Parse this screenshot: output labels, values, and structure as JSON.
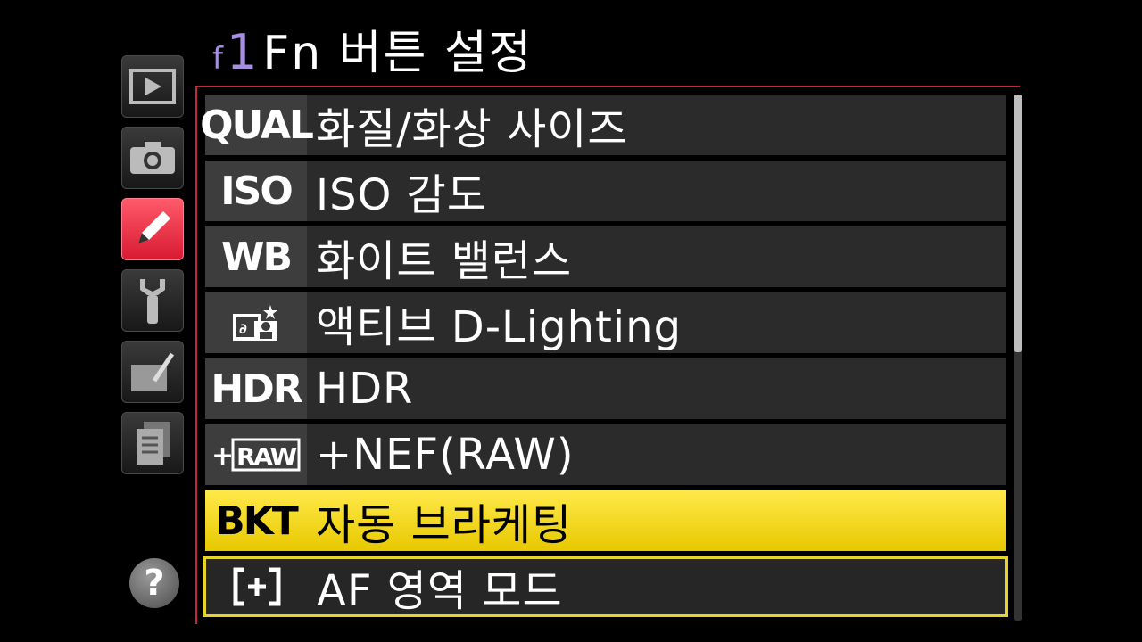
{
  "title": {
    "section_code": "f",
    "item_number": "1",
    "text": "Fn 버튼 설정"
  },
  "tabs": [
    {
      "id": "playback",
      "icon": "playback-icon"
    },
    {
      "id": "shooting",
      "icon": "camera-icon"
    },
    {
      "id": "custom",
      "icon": "pencil-icon",
      "active": true
    },
    {
      "id": "setup",
      "icon": "wrench-icon"
    },
    {
      "id": "retouch",
      "icon": "retouch-icon"
    },
    {
      "id": "recent",
      "icon": "recent-settings-icon"
    }
  ],
  "help": {
    "label": "?"
  },
  "menu": {
    "items": [
      {
        "code": "QUAL",
        "label": "화질/화상 사이즈"
      },
      {
        "code": "ISO",
        "label": "ISO 감도"
      },
      {
        "code": "WB",
        "label": "화이트 밸런스"
      },
      {
        "code": "",
        "icon": "active-d-lighting-icon",
        "label": "액티브 D-Lighting"
      },
      {
        "code": "HDR",
        "label": "HDR"
      },
      {
        "code": "",
        "icon": "nef-raw-icon",
        "label": "+NEF(RAW)"
      },
      {
        "code": "BKT",
        "label": "자동 브라케팅",
        "state": "selected"
      },
      {
        "code": "",
        "icon": "af-area-icon",
        "label": "AF 영역 모드",
        "state": "outlined"
      }
    ]
  },
  "scrollbar": {
    "position_fraction": 0.0,
    "visible_fraction": 0.49
  },
  "colors": {
    "accent_red": "#c22a3a",
    "highlight_yellow": "#ffe94a",
    "title_purple": "#a88ee0"
  }
}
